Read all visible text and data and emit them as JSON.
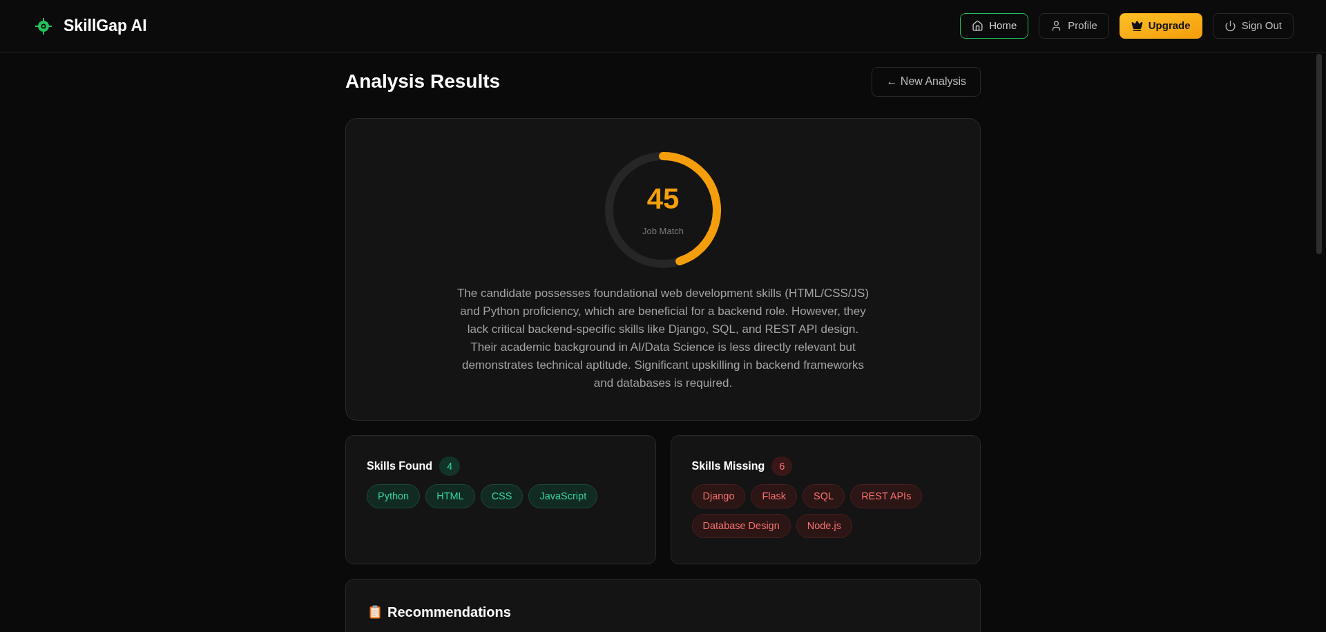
{
  "brand": {
    "name": "SkillGap AI"
  },
  "nav": [
    {
      "label": "Home",
      "kind": "link",
      "selected": true
    },
    {
      "label": "Profile",
      "kind": "link",
      "selected": false
    },
    {
      "label": "Upgrade",
      "kind": "premium",
      "selected": false
    },
    {
      "label": "Sign Out",
      "kind": "link",
      "selected": false
    }
  ],
  "page": {
    "title": "Analysis Results",
    "action": "← New Analysis"
  },
  "score": {
    "value": "45",
    "label": "Job Match",
    "level": 0.45,
    "summary": "The candidate possesses foundational web development skills (HTML/CSS/JS) and Python proficiency, which are beneficial for a backend role. However, they lack critical backend-specific skills like Django, SQL, and REST API design. Their academic background in AI/Data Science is less directly relevant but demonstrates technical aptitude. Significant upskilling in backend frameworks and databases is required."
  },
  "skill_groups": [
    {
      "title": "Skills Found",
      "count": "4",
      "kind": "found",
      "skills": [
        "Python",
        "HTML",
        "CSS",
        "JavaScript"
      ]
    },
    {
      "title": "Skills Missing",
      "count": "6",
      "kind": "missing",
      "skills": [
        "Django",
        "Flask",
        "SQL",
        "REST APIs",
        "Database Design",
        "Node.js"
      ]
    }
  ],
  "recommendations": {
    "title": "Recommendations"
  }
}
